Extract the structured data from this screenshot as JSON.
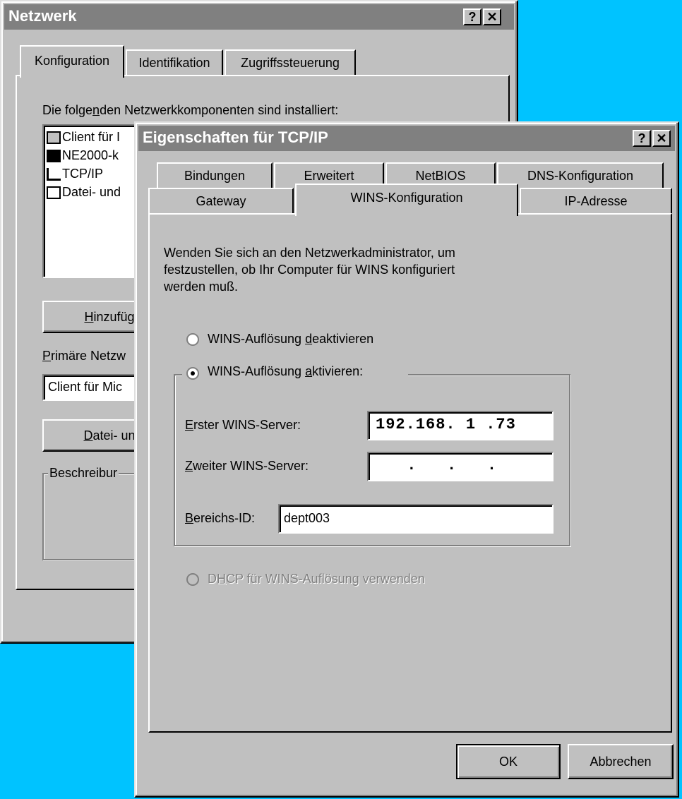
{
  "netzwerk": {
    "title": "Netzwerk",
    "help": "?",
    "close": "✕",
    "tabs": [
      "Konfiguration",
      "Identifikation",
      "Zugriffssteuerung"
    ],
    "components_label_pre": "Die folge",
    "components_label_ul": "n",
    "components_label_post": "den Netzwerkkomponenten sind installiert:",
    "components": [
      "Client für I",
      "NE2000-k",
      "TCP/IP",
      "Datei- und"
    ],
    "add_button_ul": "H",
    "add_button_rest": "inzufüge",
    "primary_label_ul": "P",
    "primary_label_rest": "rimäre Netzw",
    "primary_value": "Client für Mic",
    "file_button_ul": "D",
    "file_button_rest": "atei- und",
    "description_label": "Beschreibur"
  },
  "tcpip": {
    "title": "Eigenschaften für TCP/IP",
    "help": "?",
    "close": "✕",
    "tabs_row1": [
      "Bindungen",
      "Erweitert",
      "NetBIOS",
      "DNS-Konfiguration"
    ],
    "tabs_row2": [
      "Gateway",
      "WINS-Konfiguration",
      "IP-Adresse"
    ],
    "info_text_1": "Wenden Sie sich an den Netzwerkadministrator, um",
    "info_text_2": "festzustellen, ob Ihr Computer für WINS konfiguriert",
    "info_text_3": "werden muß.",
    "radio_disable_pre": "WINS-Auflösung ",
    "radio_disable_ul": "d",
    "radio_disable_post": "eaktivieren",
    "radio_enable_pre": "WINS-Auflösung ",
    "radio_enable_ul": "a",
    "radio_enable_post": "ktivieren:",
    "first_server_ul": "E",
    "first_server_rest": "rster WINS-Server:",
    "first_server_value": "192.168. 1 .73",
    "second_server_ul": "Z",
    "second_server_rest": "weiter WINS-Server:",
    "second_server_value": " .   .   .",
    "scope_ul": "B",
    "scope_rest": "ereichs-ID:",
    "scope_value": "dept003",
    "dhcp_pre": "D",
    "dhcp_ul": "H",
    "dhcp_post": "CP für WINS-Auflösung verwenden",
    "ok": "OK",
    "cancel": "Abbrechen"
  }
}
